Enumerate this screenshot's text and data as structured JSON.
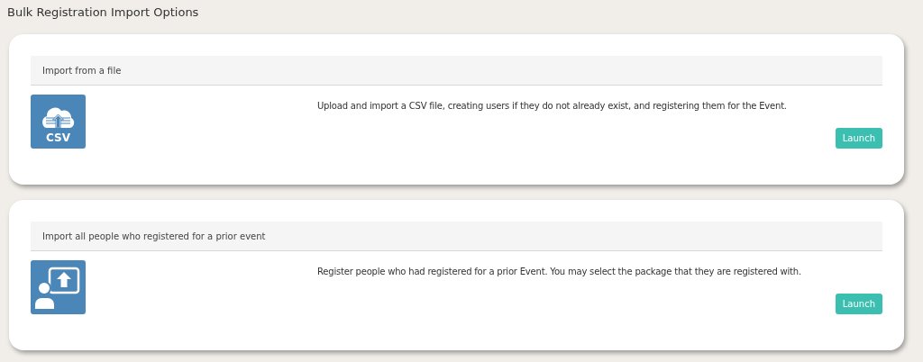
{
  "page_title": "Bulk Registration Import Options",
  "options": [
    {
      "heading": "Import from a file",
      "kind": "csv",
      "icon_text": "CSV",
      "description": "Upload and import a CSV file, creating users if they do not already exist, and registering them for the Event.",
      "button": "Launch"
    },
    {
      "heading": "Import all people who registered for a prior event",
      "kind": "people",
      "description": "Register people who had registered for a prior Event. You may select the package that they are registered with.",
      "button": "Launch"
    }
  ]
}
